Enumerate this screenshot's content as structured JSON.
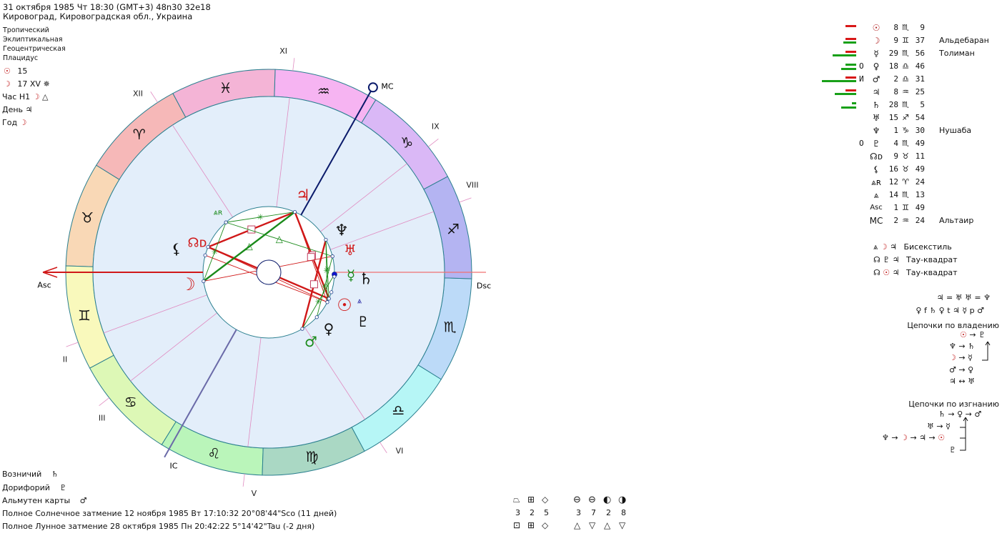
{
  "header": {
    "line1": "31 октября 1985  Чт  18:30 (GMT+3) 48n30  32e18",
    "line2": "Кировоград, Кировоградская обл., Украина"
  },
  "settings": [
    "Тропический",
    "Эклиптикальная",
    "Геоцентрическая",
    "Плацидус"
  ],
  "info": [
    {
      "glyph": "☉",
      "red": true,
      "text": "15",
      "extra": ""
    },
    {
      "glyph": "☽",
      "red": true,
      "text": "17 XV",
      "extra": "✵"
    },
    {
      "label": "Час H1",
      "glyph": "☽",
      "red": true,
      "extra": "△"
    },
    {
      "label": "День",
      "glyph": "♃",
      "red": false
    },
    {
      "label": "Год",
      "glyph": "☽",
      "red": true
    }
  ],
  "bottom_left": [
    {
      "label": "Возничий",
      "glyph": "♄"
    },
    {
      "label": "Дорифорий",
      "glyph": "♇"
    },
    {
      "label": "Альмутен карты",
      "glyph": "♂"
    }
  ],
  "eclipses": [
    "Полное Солнечное затмение 12 ноября 1985 Вт 17:10:32 20°08'44\"Sco (11 дней)",
    "Полное Лунное затмение 28 октября 1985 Пн 20:42:22  5°14'42\"Tau (-2 дня)"
  ],
  "colors": {
    "red": "#d01818",
    "green": "#1a8a1a",
    "navy": "#0a1a6a",
    "house_line": "#e08ac0",
    "chart_bg": "#e3eefa"
  },
  "signs": [
    {
      "glyph": "♈",
      "color": "#f6b8b8"
    },
    {
      "glyph": "♉",
      "color": "#f9d8b6"
    },
    {
      "glyph": "♊",
      "color": "#f9f9bc"
    },
    {
      "glyph": "♋",
      "color": "#ddf8b6"
    },
    {
      "glyph": "♌",
      "color": "#baf5ba"
    },
    {
      "glyph": "♍",
      "color": "#aad8c4"
    },
    {
      "glyph": "♎",
      "color": "#b6f6f6"
    },
    {
      "glyph": "♏",
      "color": "#bcdaf8"
    },
    {
      "glyph": "♐",
      "color": "#b4b4f2"
    },
    {
      "glyph": "♑",
      "color": "#dab8f6"
    },
    {
      "glyph": "♒",
      "color": "#f6b4f2"
    },
    {
      "glyph": "♓",
      "color": "#f4b4d6"
    }
  ],
  "angles": {
    "asc": 61.82,
    "asc_label": "Asc",
    "dsc_label": "Dsc",
    "mc_label": "MC",
    "ic_label": "IC",
    "mc": 302.4
  },
  "houses": [
    {
      "label": "I",
      "cusp": 61.82
    },
    {
      "label": "II",
      "cusp": 82
    },
    {
      "label": "III",
      "cusp": 100
    },
    {
      "label": "IV",
      "cusp": 122.4
    },
    {
      "label": "V",
      "cusp": 145
    },
    {
      "label": "VI",
      "cusp": 185
    },
    {
      "label": "VII",
      "cusp": 241.82
    },
    {
      "label": "VIII",
      "cusp": 262
    },
    {
      "label": "IX",
      "cusp": 280
    },
    {
      "label": "X",
      "cusp": 302.4
    },
    {
      "label": "XI",
      "cusp": 325
    },
    {
      "label": "XII",
      "cusp": 5
    }
  ],
  "planets": [
    {
      "id": "sun",
      "glyph": "☉",
      "lon": 218.15,
      "color": "#d01818",
      "mark": "",
      "deg": "8",
      "sign": "♏",
      "min": "9",
      "star": "",
      "bars": {
        "red": 5,
        "green": 0,
        "green2": 0
      }
    },
    {
      "id": "moon",
      "glyph": "☽",
      "lon": 69.62,
      "color": "#d01818",
      "mark": "",
      "deg": "9",
      "sign": "♊",
      "min": "37",
      "star": "Альдебаран",
      "bars": {
        "red": 5,
        "green": 6,
        "green2": 0
      }
    },
    {
      "id": "mercury",
      "glyph": "☿",
      "lon": 239.93,
      "color": "#1a8a1a",
      "mark": "",
      "deg": "29",
      "sign": "♏",
      "min": "56",
      "star": "Толиман",
      "bars": {
        "red": 5,
        "green": 11,
        "green2": 0
      }
    },
    {
      "id": "venus",
      "glyph": "♀",
      "lon": 198.77,
      "color": "#111111",
      "mark": "О",
      "deg": "18",
      "sign": "♎",
      "min": "46",
      "star": "",
      "bars": {
        "red": 0,
        "green": 5,
        "green2": 7
      }
    },
    {
      "id": "mars",
      "glyph": "♂",
      "lon": 182.52,
      "color": "#1a8a1a",
      "mark": "И",
      "deg": "2",
      "sign": "♎",
      "min": "31",
      "star": "",
      "bars": {
        "red": 5,
        "green": 16,
        "green2": 0
      }
    },
    {
      "id": "jupiter",
      "glyph": "♃",
      "lon": 308.42,
      "color": "#d01818",
      "mark": "",
      "deg": "8",
      "sign": "♒",
      "min": "25",
      "star": "",
      "bars": {
        "red": 5,
        "green": 10,
        "green2": 0
      }
    },
    {
      "id": "saturn",
      "glyph": "♄",
      "lon": 238.08,
      "color": "#111111",
      "mark": "",
      "deg": "28",
      "sign": "♏",
      "min": "5",
      "star": "",
      "bars": {
        "red": 0,
        "green": 2,
        "green2": 7
      }
    },
    {
      "id": "uranus",
      "glyph": "♅",
      "lon": 255.9,
      "color": "#d01818",
      "mark": "",
      "deg": "15",
      "sign": "♐",
      "min": "54",
      "star": "",
      "bars": {
        "red": 0,
        "green": 0,
        "green2": 0
      }
    },
    {
      "id": "neptune",
      "glyph": "♆",
      "lon": 271.5,
      "color": "#111111",
      "mark": "",
      "deg": "1",
      "sign": "♑",
      "min": "30",
      "star": "Нушаба",
      "bars": {
        "red": 0,
        "green": 0,
        "green2": 0
      }
    },
    {
      "id": "pluto",
      "glyph": "♇",
      "lon": 214.82,
      "color": "#111111",
      "mark": "О",
      "deg": "4",
      "sign": "♏",
      "min": "49",
      "star": "",
      "bars": {
        "red": 0,
        "green": 0,
        "green2": 0
      }
    },
    {
      "id": "node",
      "glyph": "☊ᴅ",
      "lon": 39.18,
      "color": "#d01818",
      "mark": "",
      "deg": "9",
      "sign": "♉",
      "min": "11",
      "star": "",
      "bars": {
        "red": 0,
        "green": 0,
        "green2": 0
      }
    },
    {
      "id": "lilith",
      "glyph": "⚸",
      "lon": 46.82,
      "color": "#111111",
      "mark": "",
      "deg": "16",
      "sign": "♉",
      "min": "49",
      "star": "",
      "bars": {
        "red": 0,
        "green": 0,
        "green2": 0
      }
    },
    {
      "id": "selena",
      "glyph": "⩓ʀ",
      "lon": 12.4,
      "color": "#1a8a1a",
      "mark": "",
      "deg": "12",
      "sign": "♈",
      "min": "24",
      "star": "",
      "bars": {
        "red": 0,
        "green": 0,
        "green2": 0
      }
    },
    {
      "id": "point",
      "glyph": "⩓",
      "lon": 224.2,
      "color": "#2020a0",
      "mark": "",
      "deg": "14",
      "sign": "♏",
      "min": "13",
      "star": "",
      "bars": {
        "red": 0,
        "green": 0,
        "green2": 0
      }
    },
    {
      "id": "asc",
      "glyph": "Asc",
      "lon": 61.82,
      "color": "#111111",
      "mark": "",
      "deg": "1",
      "sign": "♊",
      "min": "49",
      "star": "",
      "bars": {
        "red": 0,
        "green": 0,
        "green2": 0
      }
    },
    {
      "id": "mc",
      "glyph": "MC",
      "lon": 302.4,
      "color": "#111111",
      "mark": "",
      "deg": "2",
      "sign": "♒",
      "min": "24",
      "star": "Альтаир",
      "bars": {
        "red": 0,
        "green": 0,
        "green2": 0
      }
    }
  ],
  "aspects": [
    {
      "a": "node",
      "b": "jupiter",
      "type": "square",
      "strong": true
    },
    {
      "a": "node",
      "b": "sun",
      "type": "opposition",
      "strong": true
    },
    {
      "a": "node",
      "b": "pluto",
      "type": "opposition",
      "strong": false
    },
    {
      "a": "lilith",
      "b": "pluto",
      "type": "opposition",
      "strong": false
    },
    {
      "a": "moon",
      "b": "jupiter",
      "type": "trine",
      "strong": true
    },
    {
      "a": "jupiter",
      "b": "sun",
      "type": "square",
      "strong": true
    },
    {
      "a": "jupiter",
      "b": "pluto",
      "type": "square",
      "strong": false
    },
    {
      "a": "selena",
      "b": "jupiter",
      "type": "sextile",
      "strong": false
    },
    {
      "a": "selena",
      "b": "uranus",
      "type": "trine",
      "strong": false
    },
    {
      "a": "selena",
      "b": "moon",
      "type": "sextile",
      "strong": false
    },
    {
      "a": "moon",
      "b": "uranus",
      "type": "opposition",
      "strong": false
    },
    {
      "a": "mars",
      "b": "neptune",
      "type": "square",
      "strong": true
    },
    {
      "a": "venus",
      "b": "uranus",
      "type": "sextile",
      "strong": false
    },
    {
      "a": "mars",
      "b": "mercury",
      "type": "sextile",
      "strong": false
    },
    {
      "a": "neptune",
      "b": "sun",
      "type": "sextile",
      "strong": false
    },
    {
      "a": "neptune",
      "b": "pluto",
      "type": "sextile",
      "strong": false
    }
  ],
  "configurations": [
    {
      "glyphs": [
        "⩓",
        "☽",
        "♃"
      ],
      "red": [
        false,
        true,
        false
      ],
      "label": "Бисекстиль"
    },
    {
      "glyphs": [
        "☊",
        "♇",
        "♃"
      ],
      "red": [
        false,
        false,
        false
      ],
      "label": "Тау-квадрат"
    },
    {
      "glyphs": [
        "☊",
        "☉",
        "♃"
      ],
      "red": [
        false,
        true,
        false
      ],
      "label": "Тау-квадрат"
    }
  ],
  "receptions": {
    "line1": "♃ = ♅  ♅ = ♆",
    "line2": "♀ f ♄  ♀ t ♃  ☿ p ♂"
  },
  "chains_rulership": {
    "title": "Цепочки по владению",
    "rows": [
      "☉ → ♇",
      "♆ → ♄",
      "☽ → ☿",
      "♂ → ♀",
      "♃ ↔ ♅"
    ]
  },
  "chains_exile": {
    "title": "Цепочки по изгнанию",
    "rows": [
      "♄ → ♀ → ♂",
      "♅ → ☿",
      "♆ → ☽ → ♃ → ☉",
      "♇"
    ]
  },
  "stats": {
    "row1_icons": [
      "⏢",
      "⊞",
      "◇"
    ],
    "row1_values": [
      "3",
      "2",
      "5"
    ],
    "row1b_icons": [
      "⊖",
      "⊖",
      "◐",
      "◑"
    ],
    "row1b_values": [
      "3",
      "7",
      "2",
      "8"
    ],
    "row2_icons": [
      "⊡",
      "⊞",
      "◇"
    ],
    "row2b_icons": [
      "△",
      "▽",
      "△",
      "▽"
    ]
  }
}
